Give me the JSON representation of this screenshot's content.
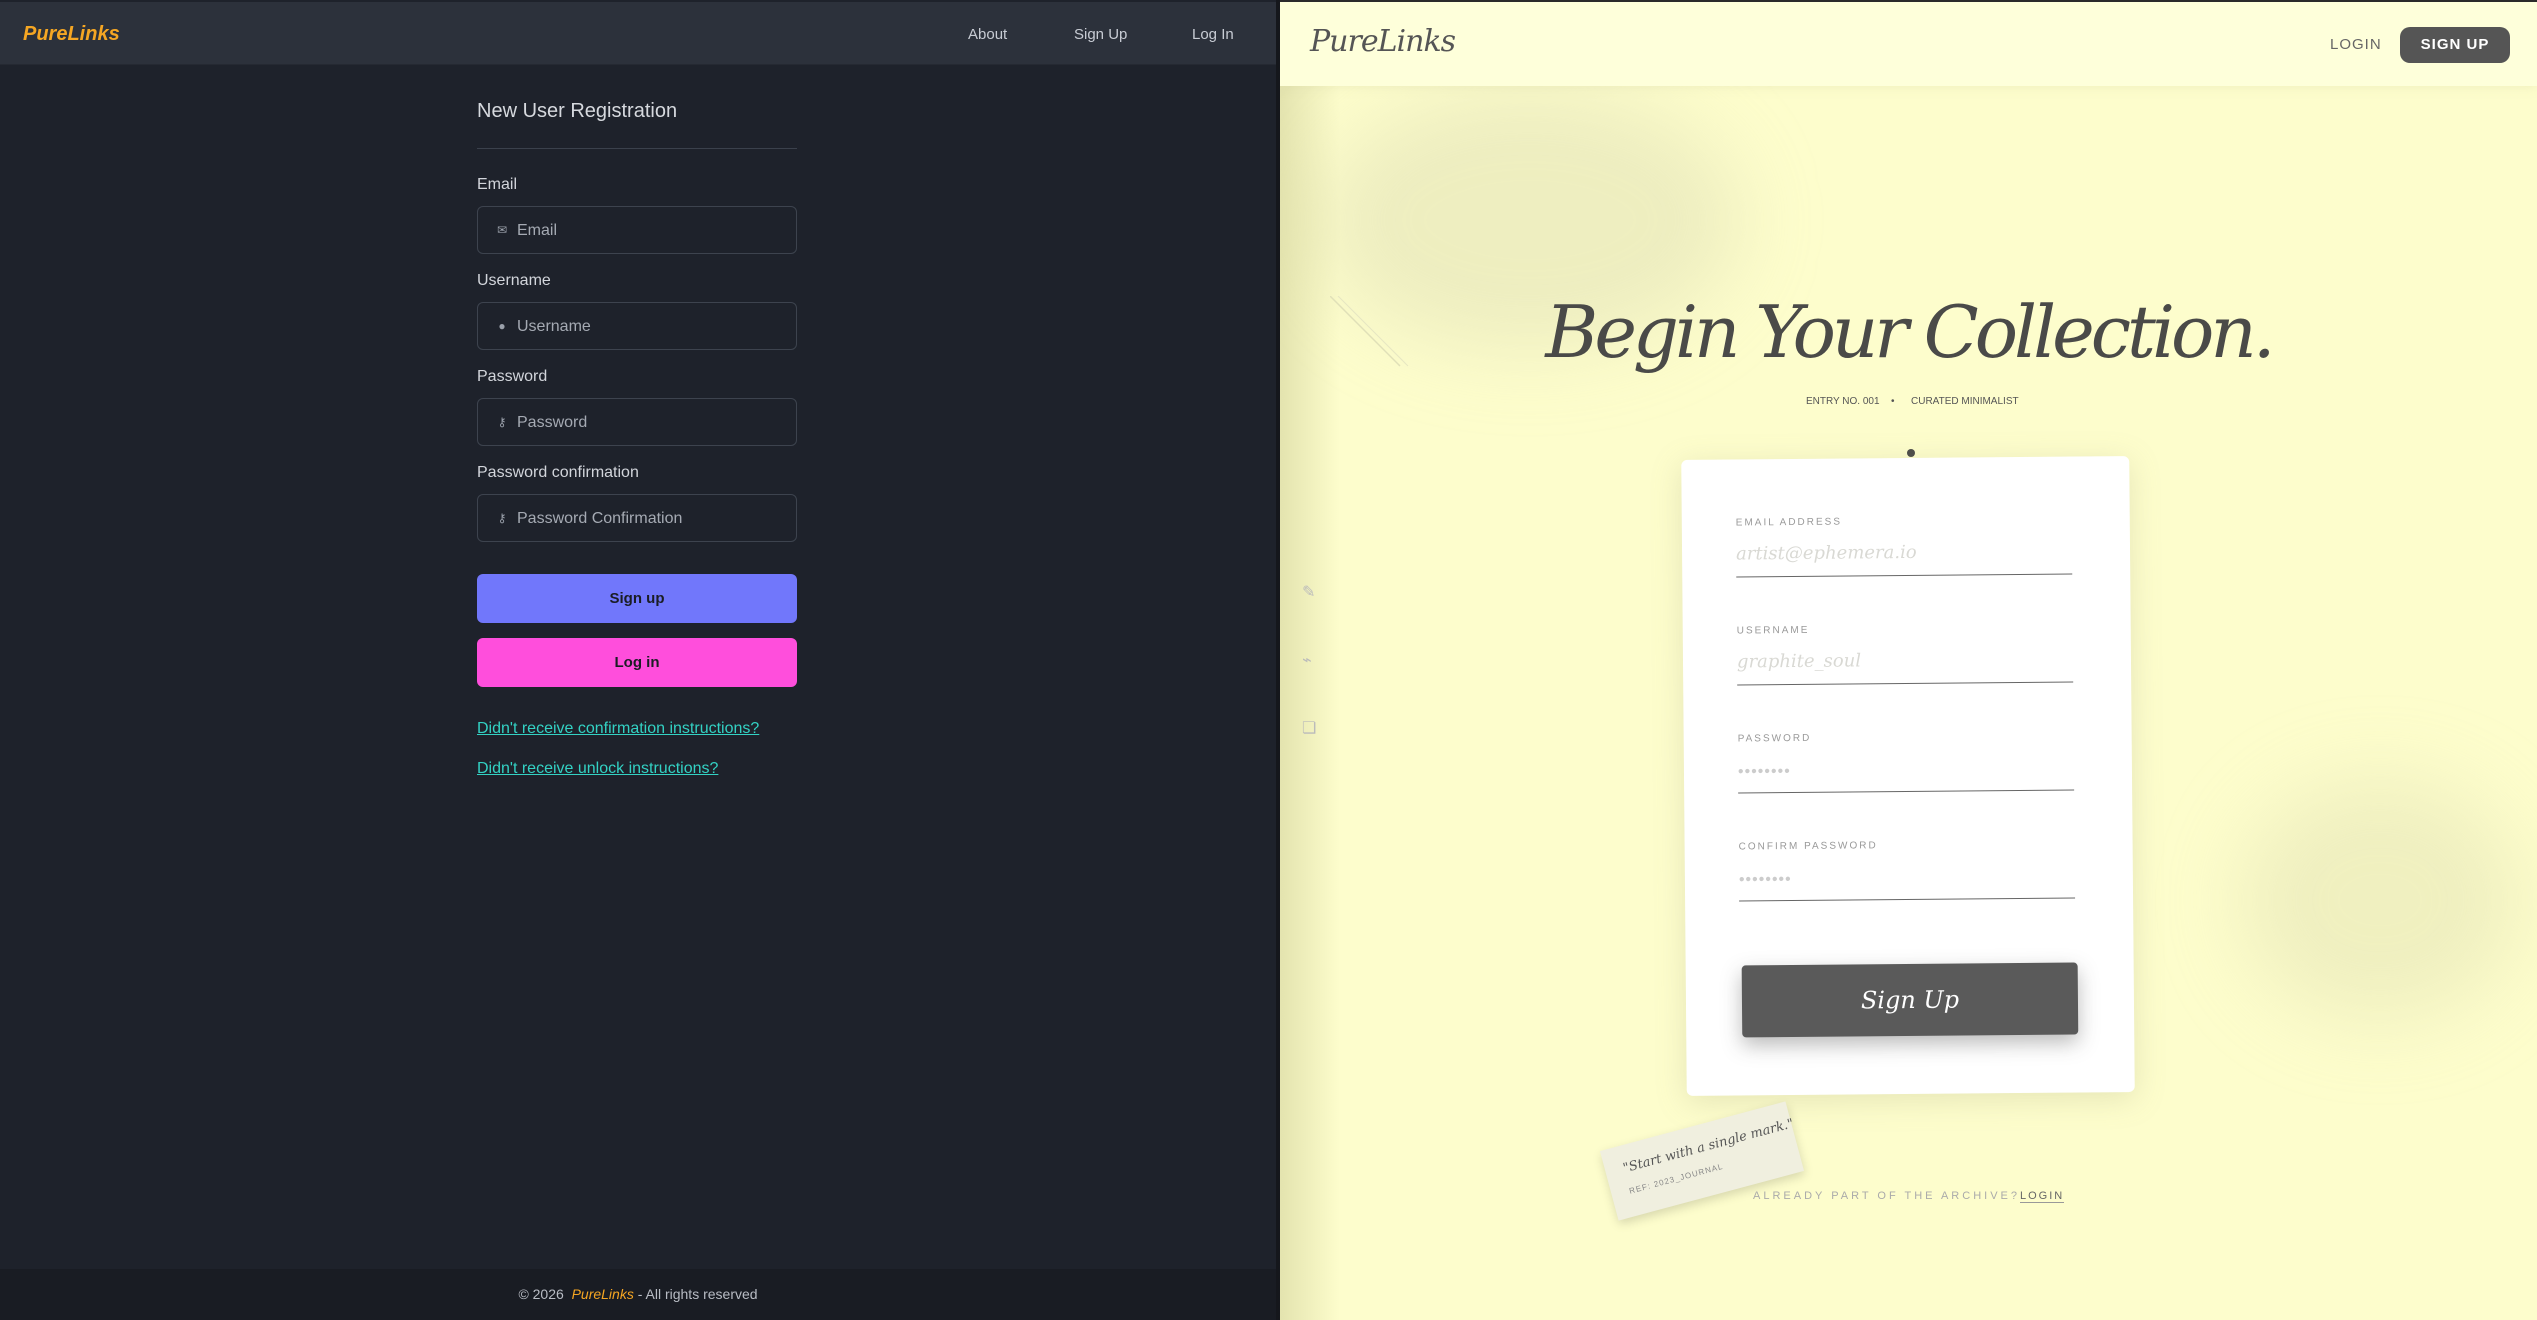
{
  "left": {
    "brand": "PureLinks",
    "nav": {
      "about": "About",
      "signup": "Sign Up",
      "login": "Log In"
    },
    "form": {
      "title": "New User Registration",
      "email": {
        "label": "Email",
        "placeholder": "Email",
        "icon": "envelope-icon"
      },
      "username": {
        "label": "Username",
        "placeholder": "Username",
        "icon": "user-icon"
      },
      "password": {
        "label": "Password",
        "placeholder": "Password",
        "icon": "key-icon"
      },
      "password_confirmation": {
        "label": "Password confirmation",
        "placeholder": "Password Confirmation",
        "icon": "key-icon"
      },
      "signup_button": "Sign up",
      "login_button": "Log in",
      "links": [
        "Didn't receive confirmation instructions?",
        "Didn't receive unlock instructions?"
      ]
    },
    "footer": {
      "prefix": "© 2026",
      "brand": "PureLinks",
      "suffix": "- All rights reserved"
    },
    "colors": {
      "brand": "#f5a623",
      "signup": "#7177fb",
      "login": "#ff4edc",
      "link": "#33d2c4"
    }
  },
  "right": {
    "brand": "PureLinks",
    "nav": {
      "login": "LOGIN",
      "signup": "SIGN UP"
    },
    "hero": "Begin Your Collection.",
    "subtitle": {
      "entry": "ENTRY NO. 001",
      "sep": "•",
      "tag": "CURATED MINIMALIST"
    },
    "form": {
      "email": {
        "label": "EMAIL ADDRESS",
        "placeholder": "artist@ephemera.io"
      },
      "username": {
        "label": "USERNAME",
        "placeholder": "graphite_soul"
      },
      "password": {
        "label": "PASSWORD",
        "placeholder": "••••••••"
      },
      "confirm": {
        "label": "CONFIRM PASSWORD",
        "placeholder": "••••••••"
      },
      "submit": "Sign Up"
    },
    "quote": {
      "text": "\"Start with a single mark.\"",
      "ref": "REF: 2023_JOURNAL"
    },
    "archive": {
      "question": "ALREADY PART OF THE ARCHIVE?",
      "login": "LOGIN"
    },
    "side_icons": [
      "pencil-icon",
      "brush-icon",
      "layers-icon"
    ],
    "colors": {
      "background": "#fdfdcc",
      "button": "#5a5a5a"
    }
  }
}
